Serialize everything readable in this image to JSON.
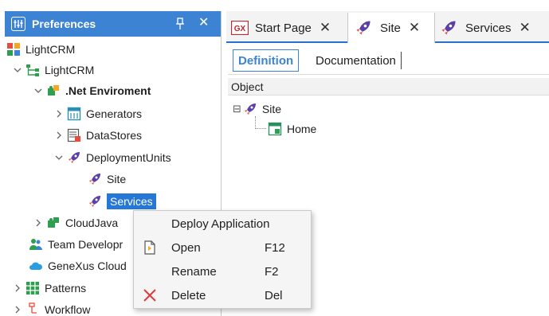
{
  "preferences_panel": {
    "title": "Preferences",
    "close_glyph": "✕",
    "tree": [
      {
        "label": "LightCRM",
        "icon": "cube-icon"
      },
      {
        "label": "LightCRM",
        "icon": "hierarchy-icon"
      },
      {
        "label": ".Net Enviroment",
        "icon": "puzzle-icon",
        "bold": true
      },
      {
        "label": "Generators",
        "icon": "generator-icon"
      },
      {
        "label": "DataStores",
        "icon": "datastore-icon"
      },
      {
        "label": "DeploymentUnits",
        "icon": "rocket-icon"
      },
      {
        "label": "Site",
        "icon": "rocket-icon"
      },
      {
        "label": "Services",
        "icon": "rocket-icon",
        "selected": true
      },
      {
        "label": "CloudJava",
        "icon": "puzzle-icon"
      },
      {
        "label": "Team Developr",
        "icon": "team-icon"
      },
      {
        "label": "GeneXus Cloud",
        "icon": "cloud-icon"
      },
      {
        "label": "Patterns",
        "icon": "patterns-icon"
      },
      {
        "label": "Workflow",
        "icon": "workflow-icon"
      }
    ]
  },
  "tabs": [
    {
      "label": "Start Page",
      "icon": "genexus-icon",
      "close": "✕"
    },
    {
      "label": "Site",
      "icon": "rocket-icon",
      "close": "✕",
      "active": true
    },
    {
      "label": "Services",
      "icon": "rocket-icon",
      "close": "✕"
    }
  ],
  "subtabs": [
    {
      "label": "Definition",
      "active": true
    },
    {
      "label": "Documentation"
    }
  ],
  "object_panel": {
    "header": "Object",
    "tree": [
      {
        "label": "Site",
        "icon": "rocket-icon",
        "expander": "⊟"
      },
      {
        "label": "Home",
        "icon": "webpanel-icon"
      }
    ]
  },
  "context_menu": {
    "items": [
      {
        "label": "Deploy Application",
        "shortcut": "",
        "icon": ""
      },
      {
        "label": "Open",
        "shortcut": "F12",
        "icon": "open-icon"
      },
      {
        "label": "Rename",
        "shortcut": "F2",
        "icon": ""
      },
      {
        "label": "Delete",
        "shortcut": "Del",
        "icon": "delete-icon"
      }
    ]
  },
  "colors": {
    "accent": "#3c83d3",
    "selection": "#2677d6",
    "rocket": "#5b3fa8",
    "delete": "#e0393e"
  }
}
